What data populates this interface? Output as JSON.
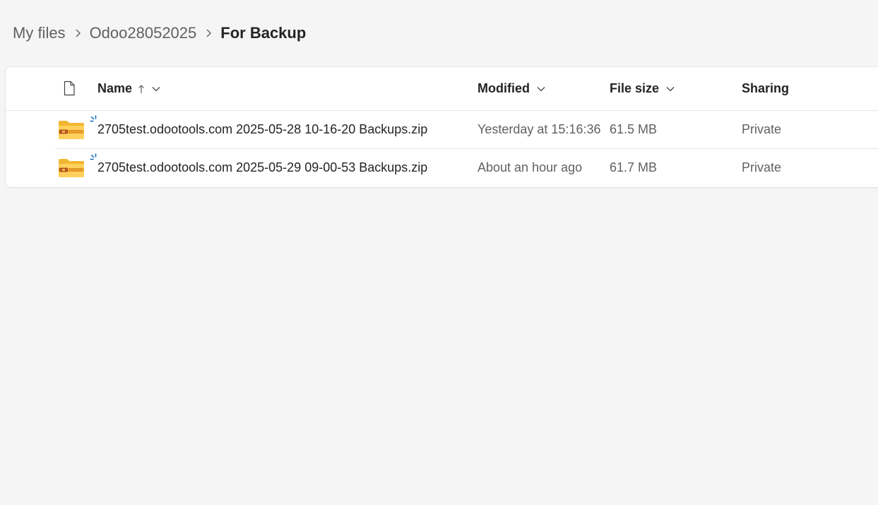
{
  "breadcrumb": {
    "items": [
      "My files",
      "Odoo28052025"
    ],
    "current": "For Backup"
  },
  "columns": {
    "name": "Name",
    "modified": "Modified",
    "file_size": "File size",
    "sharing": "Sharing",
    "name_sort_icon": "arrow-up-icon",
    "dropdown_icon": "chevron-down-icon",
    "file_type_icon": "document-icon"
  },
  "files": [
    {
      "name": "2705test.odootools.com 2025-05-28 10-16-20 Backups.zip",
      "modified": "Yesterday at 15:16:36",
      "size": "61.5 MB",
      "sharing": "Private",
      "icon": "zip-folder-icon",
      "badge": "new-file-icon"
    },
    {
      "name": "2705test.odootools.com 2025-05-29 09-00-53 Backups.zip",
      "modified": "About an hour ago",
      "size": "61.7 MB",
      "sharing": "Private",
      "icon": "zip-folder-icon",
      "badge": "new-file-icon"
    }
  ],
  "colors": {
    "background": "#f5f5f5",
    "card": "#ffffff",
    "text_primary": "#242424",
    "text_secondary": "#616161",
    "folder_yellow": "#ffd05c",
    "folder_dark": "#f2b632",
    "zip_brown": "#b3561d",
    "accent_blue": "#0f6cbd"
  }
}
